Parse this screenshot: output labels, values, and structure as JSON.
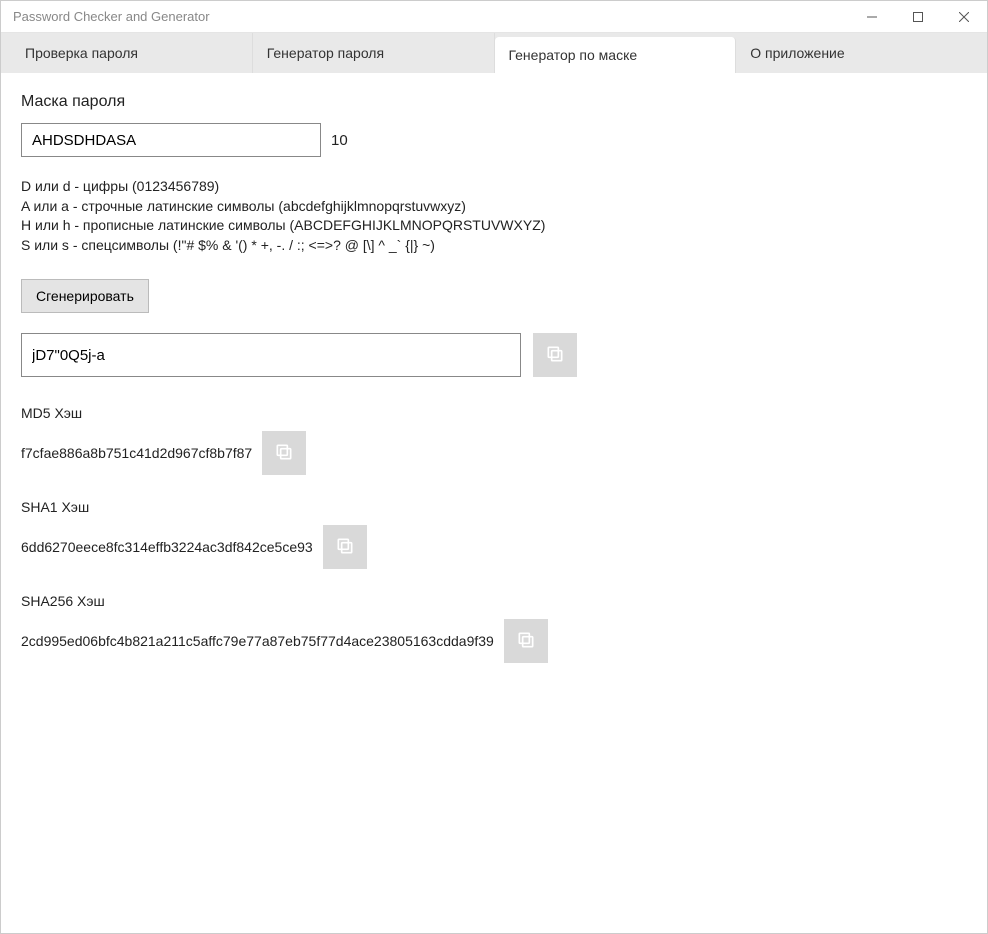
{
  "window": {
    "title": "Password Checker and Generator"
  },
  "tabs": {
    "check": "Проверка пароля",
    "generator": "Генератор пароля",
    "mask": "Генератор по маске",
    "about": "О приложение"
  },
  "mask": {
    "label": "Маска пароля",
    "value": "AHDSDHDASA",
    "count": "10",
    "hint1": "D или d - цифры (0123456789)",
    "hint2": "A или a - строчные латинские символы (abcdefghijklmnopqrstuvwxyz)",
    "hint3": "H или h - прописные латинские символы (ABCDEFGHIJKLMNOPQRSTUVWXYZ)",
    "hint4": "S или s - спецсимволы (!\"# $% & '() * +, -. / :; <=>? @ [\\] ^ _` {|} ~)"
  },
  "generate": {
    "button": "Сгенерировать",
    "result": "jD7\"0Q5j-a"
  },
  "hashes": {
    "md5": {
      "label": "MD5 Хэш",
      "value": "f7cfae886a8b751c41d2d967cf8b7f87"
    },
    "sha1": {
      "label": "SHA1 Хэш",
      "value": "6dd6270eece8fc314effb3224ac3df842ce5ce93"
    },
    "sha256": {
      "label": "SHA256 Хэш",
      "value": "2cd995ed06bfc4b821a211c5affc79e77a87eb75f77d4ace23805163cdda9f39"
    }
  }
}
